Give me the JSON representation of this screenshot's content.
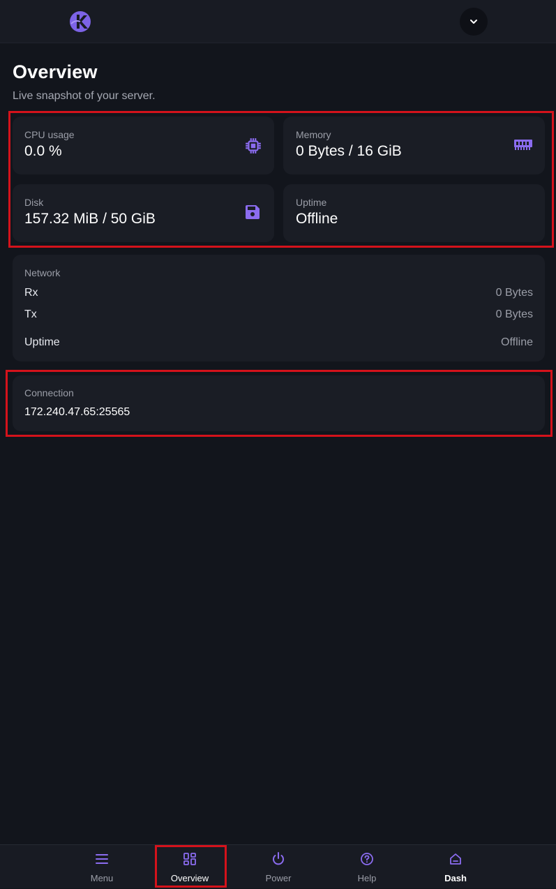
{
  "header": {
    "logo_icon": "kyro-logo-icon",
    "account_icon": "chevron-down-icon"
  },
  "page": {
    "title": "Overview",
    "subtitle": "Live snapshot of your server."
  },
  "stats": {
    "cpu": {
      "label": "CPU usage",
      "value": "0.0 %",
      "icon": "cpu-chip-icon"
    },
    "memory": {
      "label": "Memory",
      "value": "0 Bytes / 16 GiB",
      "icon": "memory-ram-icon"
    },
    "disk": {
      "label": "Disk",
      "value": "157.32 MiB / 50 GiB",
      "icon": "floppy-disk-icon"
    },
    "uptime": {
      "label": "Uptime",
      "value": "Offline"
    }
  },
  "network": {
    "label": "Network",
    "rx_label": "Rx",
    "rx_value": "0 Bytes",
    "tx_label": "Tx",
    "tx_value": "0 Bytes",
    "uptime_label": "Uptime",
    "uptime_value": "Offline"
  },
  "connection": {
    "label": "Connection",
    "address": "172.240.47.65:25565"
  },
  "bottom_nav": {
    "items": [
      {
        "label": "Menu",
        "icon": "hamburger-menu-icon"
      },
      {
        "label": "Overview",
        "icon": "dashboard-grid-icon"
      },
      {
        "label": "Power",
        "icon": "power-icon"
      },
      {
        "label": "Help",
        "icon": "help-question-icon"
      },
      {
        "label": "Dash",
        "icon": "home-icon"
      }
    ]
  },
  "colors": {
    "accent": "#8b6cf0",
    "highlight": "#d4121b",
    "background": "#12151c",
    "card": "#1a1d25"
  }
}
